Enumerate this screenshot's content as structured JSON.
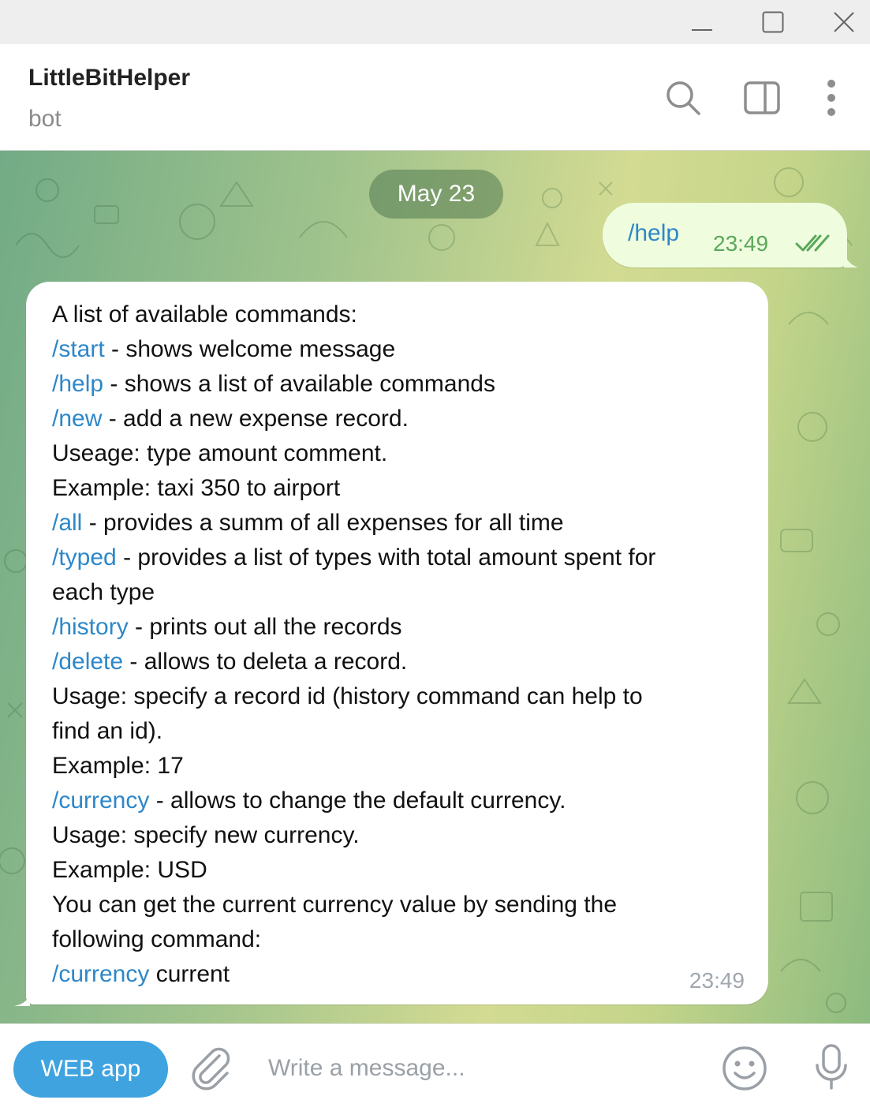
{
  "window": {
    "controls": [
      "minimize-icon",
      "maximize-icon",
      "close-icon"
    ]
  },
  "header": {
    "title": "LittleBitHelper",
    "subtitle": "bot",
    "icons": [
      "search-icon",
      "side-panel-icon",
      "more-vertical-icon"
    ]
  },
  "chat": {
    "date_label": "May 23",
    "outgoing": {
      "text": "/help",
      "time": "23:49",
      "status": "read"
    },
    "incoming": {
      "time": "23:49",
      "lines": [
        [
          {
            "t": "A list of available commands:"
          }
        ],
        [
          {
            "t": "/start",
            "cmd": true
          },
          {
            "t": " - shows welcome message"
          }
        ],
        [
          {
            "t": "/help",
            "cmd": true
          },
          {
            "t": " - shows a list of available commands"
          }
        ],
        [
          {
            "t": "/new",
            "cmd": true
          },
          {
            "t": " - add a new expense record."
          }
        ],
        [
          {
            "t": "Useage: type amount comment."
          }
        ],
        [
          {
            "t": "Example: taxi 350 to airport"
          }
        ],
        [
          {
            "t": "/all",
            "cmd": true
          },
          {
            "t": " - provides a summ of all expenses for all time"
          }
        ],
        [
          {
            "t": "/typed",
            "cmd": true
          },
          {
            "t": " - provides a list of types with total amount spent for"
          }
        ],
        [
          {
            "t": "each type"
          }
        ],
        [
          {
            "t": "/history",
            "cmd": true
          },
          {
            "t": " - prints out all the records"
          }
        ],
        [
          {
            "t": "/delete",
            "cmd": true
          },
          {
            "t": " - allows to deleta a record."
          }
        ],
        [
          {
            "t": "Usage: specify a record id (history command can help to"
          }
        ],
        [
          {
            "t": "find an id)."
          }
        ],
        [
          {
            "t": "Example: 17"
          }
        ],
        [
          {
            "t": "/currency",
            "cmd": true
          },
          {
            "t": " - allows to change the default currency."
          }
        ],
        [
          {
            "t": "Usage: specify new currency."
          }
        ],
        [
          {
            "t": "Example: USD"
          }
        ],
        [
          {
            "t": "You can get the current currency value by sending the"
          }
        ],
        [
          {
            "t": "following command:"
          }
        ],
        [
          {
            "t": "/currency",
            "cmd": true
          },
          {
            "t": " current"
          }
        ]
      ]
    }
  },
  "composer": {
    "web_app_label": "WEB app",
    "placeholder": "Write a message...",
    "icons": [
      "attach-icon",
      "emoji-icon",
      "microphone-icon"
    ]
  },
  "colors": {
    "accent": "#3fa3e0",
    "link": "#2d87c8",
    "outgoing_bubble": "#effdde",
    "read_check": "#5aa85a"
  }
}
